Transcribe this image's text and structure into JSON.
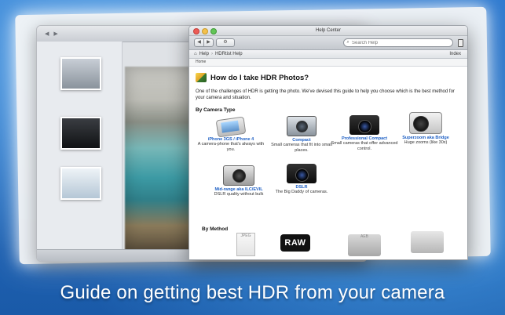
{
  "caption": "Guide on getting best HDR from your camera",
  "help_window": {
    "title": "Help Center",
    "search_placeholder": "Search Help",
    "path": [
      "Help",
      "HDRtist Help"
    ],
    "index_label": "Index",
    "home_label": "Home",
    "heading": "How do I take HDR Photos?",
    "intro": "One of the challenges of HDR is getting the photo. We've devised this guide to help you choose which is the best method for your camera and situation.",
    "section_camera": "By Camera Type",
    "cameras": [
      {
        "name": "iPhone 3GS / iPhone 4",
        "desc": "A camera-phone that's always with you.",
        "icon": "iphone-icon"
      },
      {
        "name": "Compact",
        "desc": "Small cameras that fit into small places.",
        "icon": "compact-camera-icon"
      },
      {
        "name": "Professional Compact",
        "desc": "Small cameras that offer advanced control.",
        "icon": "pro-compact-camera-icon"
      },
      {
        "name": "Superzoom aka Bridge",
        "desc": "Huge zooms (like 30x)",
        "icon": "bridge-camera-icon"
      },
      {
        "name": "Mid-range aka ILC/EVIL",
        "desc": "DSLR quality without bulk",
        "icon": "evil-camera-icon"
      },
      {
        "name": "DSLR",
        "desc": "The Big Daddy of cameras.",
        "icon": "dslr-camera-icon"
      }
    ],
    "section_method": "By Method",
    "methods": [
      {
        "label": "JPEG",
        "icon": "jpeg-file-icon"
      },
      {
        "label": "RAW",
        "icon": "raw-icon"
      },
      {
        "label": "AEB",
        "icon": "aeb-tripod-icon"
      },
      {
        "label": "",
        "icon": "multi-shot-icon"
      }
    ]
  },
  "colors": {
    "link": "#1d5fc4",
    "background": "#1b63b6"
  }
}
